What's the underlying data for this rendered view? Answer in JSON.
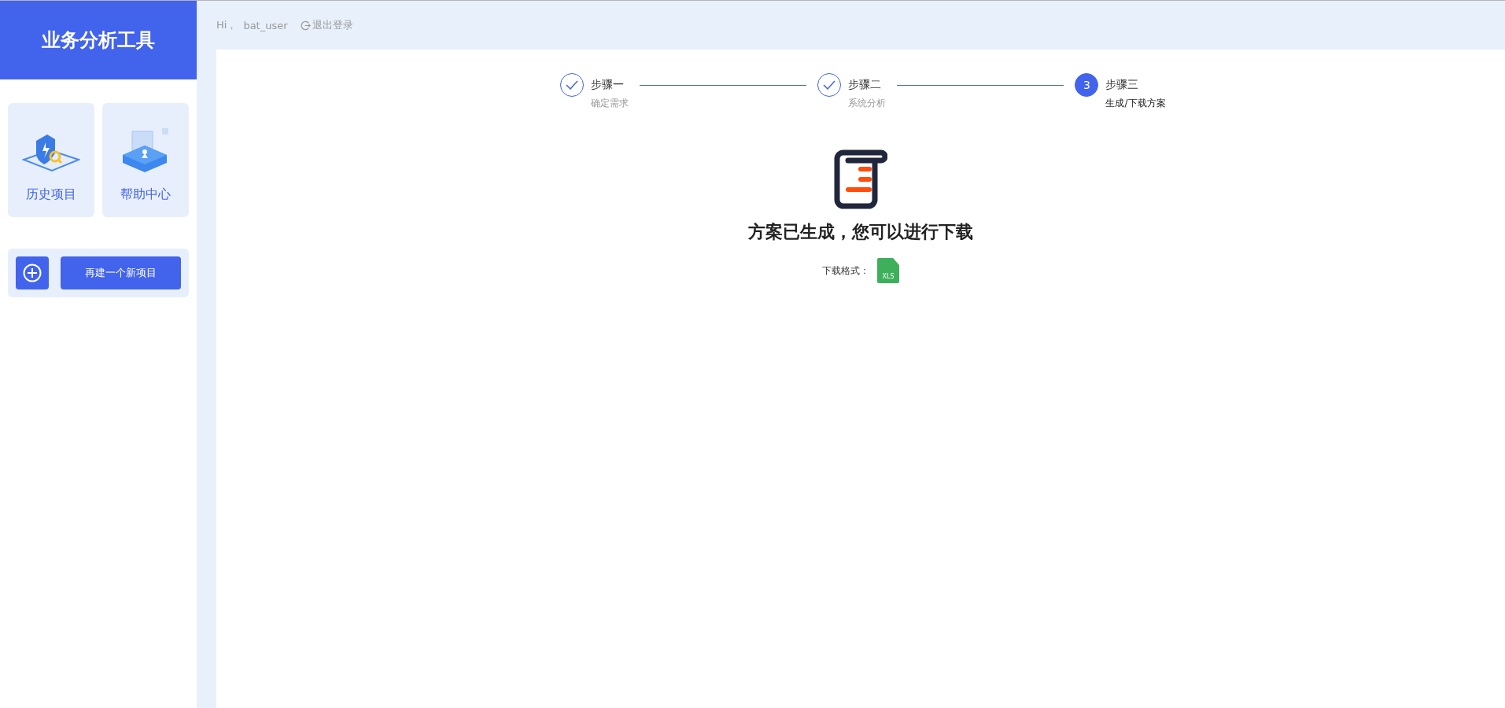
{
  "sidebar": {
    "title": "业务分析工具",
    "cards": [
      {
        "kind": "history",
        "label": "历史项目"
      },
      {
        "kind": "help",
        "label": "帮助中心"
      }
    ],
    "new_project": {
      "label": "再建一个新项目"
    }
  },
  "header": {
    "greeting": "Hi，",
    "username": "bat_user",
    "logout": "退出登录"
  },
  "steps": [
    {
      "title": "步骤一",
      "subtitle": "确定需求",
      "done": true,
      "selected": false
    },
    {
      "title": "步骤二",
      "subtitle": "系统分析",
      "done": true,
      "selected": false
    },
    {
      "title": "步骤三",
      "subtitle": "生成/下载方案",
      "done": false,
      "selected": true,
      "number": "3"
    }
  ],
  "result": {
    "message": "方案已生成，您可以进行下载",
    "format_label": "下载格式：",
    "format": "XLS"
  }
}
